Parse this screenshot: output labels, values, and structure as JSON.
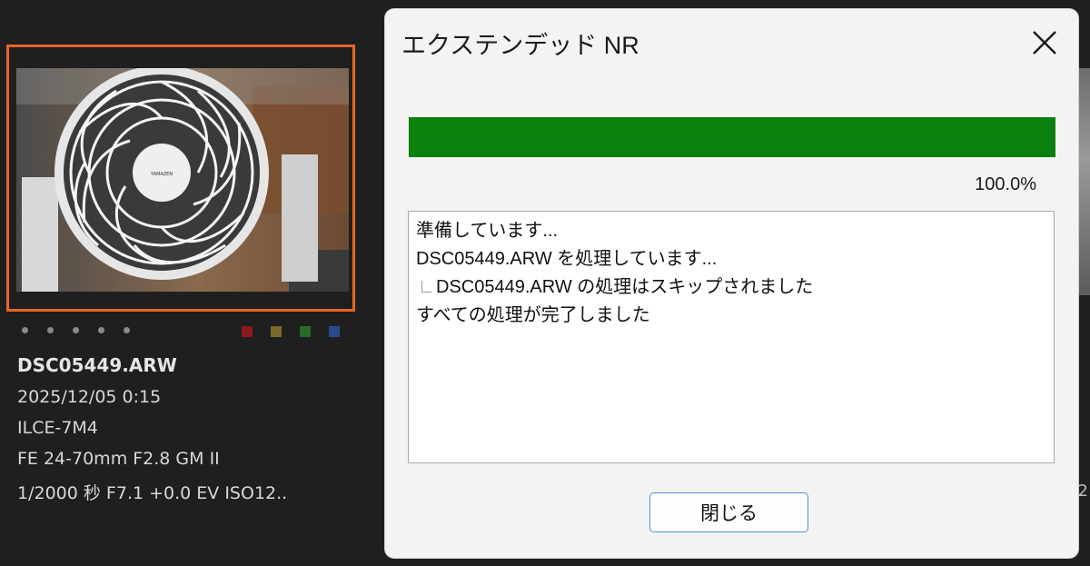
{
  "thumbnail": {
    "filename": "DSC05449.ARW",
    "date": "2025/12/05 0:15",
    "camera": "ILCE-7M4",
    "lens": "FE 24-70mm F2.8 GM II",
    "exposure": "1/2000 秒 F7.1 +0.0 EV ISO12..",
    "fan_brand": "YAMAZEN",
    "rating_dots": 5,
    "label_colors": [
      "#8b1a1a",
      "#7a6a2a",
      "#2a6a2a",
      "#2a4a8a"
    ],
    "selection_color": "#e8642a"
  },
  "right_strip_text": "2",
  "dialog": {
    "title": "エクステンデッド NR",
    "progress_value": 1.0,
    "progress_text": "100.0%",
    "progress_color": "#0a800f",
    "log_lines": [
      "準備しています...",
      "DSC05449.ARW を処理しています...",
      "DSC05449.ARW の処理はスキップされました",
      "すべての処理が完了しました"
    ],
    "close_button_label": "閉じる"
  }
}
